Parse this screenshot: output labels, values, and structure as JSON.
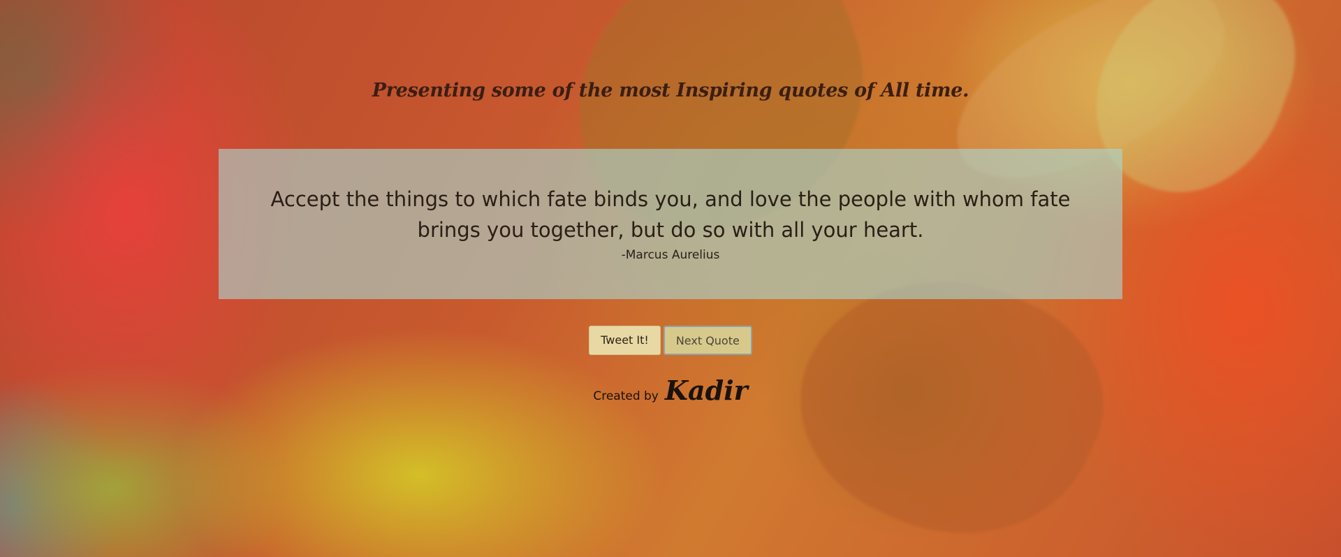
{
  "header": {
    "title": "Presenting some of the most Inspiring quotes of All time."
  },
  "quote": {
    "text": "Accept the things to which fate binds you, and love the people with whom fate brings you together, but do so with all your heart.",
    "author": "-Marcus Aurelius"
  },
  "actions": {
    "tweet_label": "Tweet It!",
    "next_label": "Next Quote"
  },
  "footer": {
    "created_by_label": "Created by",
    "author_name": "Kadir"
  },
  "colors": {
    "quote_box_bg": "#aad7d2",
    "tweet_button_bg": "#e8d9a4",
    "next_button_bg": "#d7c98c",
    "text_dark": "#2a1e16"
  }
}
